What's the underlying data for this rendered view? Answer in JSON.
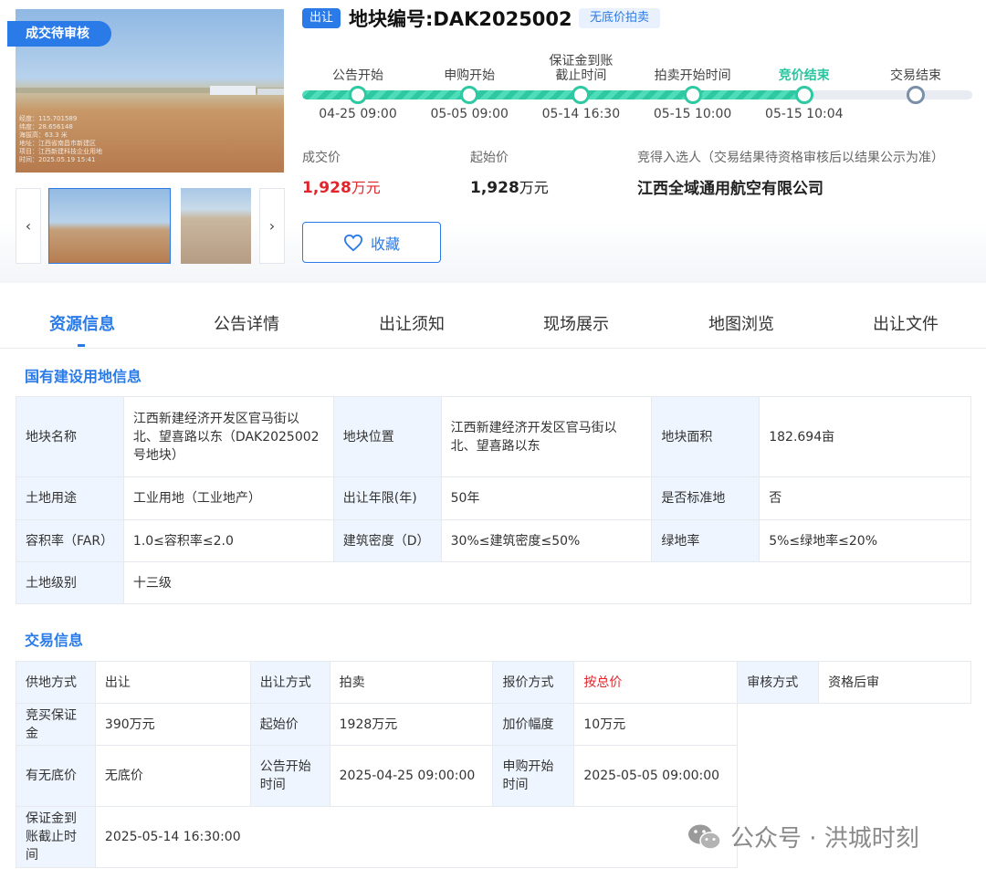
{
  "gallery": {
    "status_ribbon": "成交待审核",
    "photo_watermark": [
      "经度：115.701589",
      "纬度：28.656148",
      "海拔高：63.3 米",
      "地址：江西省南昌市新建区",
      "项目：江西新建科技企业用地",
      "时间：2025.05.19 15:41"
    ],
    "prev_icon": "‹",
    "next_icon": "›"
  },
  "header": {
    "transfer_tag": "出让",
    "plot_title": "地块编号:DAK2025002",
    "reserve_badge": "无底价拍卖"
  },
  "progress": {
    "completed_fraction": 0.75,
    "steps": [
      {
        "label": "公告开始",
        "time": "04-25 09:00",
        "state": "done"
      },
      {
        "label": "申购开始",
        "time": "05-05 09:00",
        "state": "done"
      },
      {
        "label": "保证金到账\n截止时间",
        "time": "05-14 16:30",
        "state": "done"
      },
      {
        "label": "拍卖开始时间",
        "time": "05-15 10:00",
        "state": "done"
      },
      {
        "label": "竞价结束",
        "time": "05-15 10:04",
        "state": "current"
      },
      {
        "label": "交易结束",
        "time": "",
        "state": "todo"
      }
    ]
  },
  "prices": {
    "deal_label": "成交价",
    "deal_value": "1,928",
    "deal_unit": "万元",
    "start_label": "起始价",
    "start_value": "1,928",
    "start_unit": "万元",
    "winner_label": "竞得入选人（交易结果待资格审核后以结果公示为准）",
    "winner_value": "江西全域通用航空有限公司"
  },
  "favorite": {
    "label": "收藏"
  },
  "tabs": [
    "资源信息",
    "公告详情",
    "出让须知",
    "现场展示",
    "地图浏览",
    "出让文件"
  ],
  "land_info": {
    "title": "国有建设用地信息",
    "rows": [
      [
        "地块名称",
        "江西新建经济开发区官马街以北、望喜路以东（DAK2025002号地块）",
        "地块位置",
        "江西新建经济开发区官马街以北、望喜路以东",
        "地块面积",
        "182.694亩"
      ],
      [
        "土地用途",
        "工业用地（工业地产）",
        "出让年限(年)",
        "50年",
        "是否标准地",
        "否"
      ],
      [
        "容积率（FAR）",
        "1.0≤容积率≤2.0",
        "建筑密度（D）",
        "30%≤建筑密度≤50%",
        "绿地率",
        "5%≤绿地率≤20%"
      ],
      [
        "土地级别",
        "十三级"
      ]
    ]
  },
  "trade_info": {
    "title": "交易信息",
    "row1": [
      "供地方式",
      "出让",
      "出让方式",
      "拍卖",
      "报价方式",
      "按总价",
      "审核方式",
      "资格后审"
    ],
    "row2": [
      "竞买保证金",
      "390万元",
      "起始价",
      "1928万元",
      "加价幅度",
      "10万元"
    ],
    "row3": [
      "有无底价",
      "无底价",
      "公告开始时间",
      "2025-04-25 09:00:00",
      "申购开始时间",
      "2025-05-05 09:00:00"
    ],
    "row4": [
      "保证金到账截止时间",
      "2025-05-14 16:30:00"
    ]
  },
  "watermark": {
    "text": "公众号 · 洪城时刻",
    "icon": "wechat-icon"
  },
  "colors": {
    "accent": "#2a7be8",
    "progress": "#2ec9a2",
    "price_red": "#e0262d",
    "label_bg": "#eef5fe"
  }
}
